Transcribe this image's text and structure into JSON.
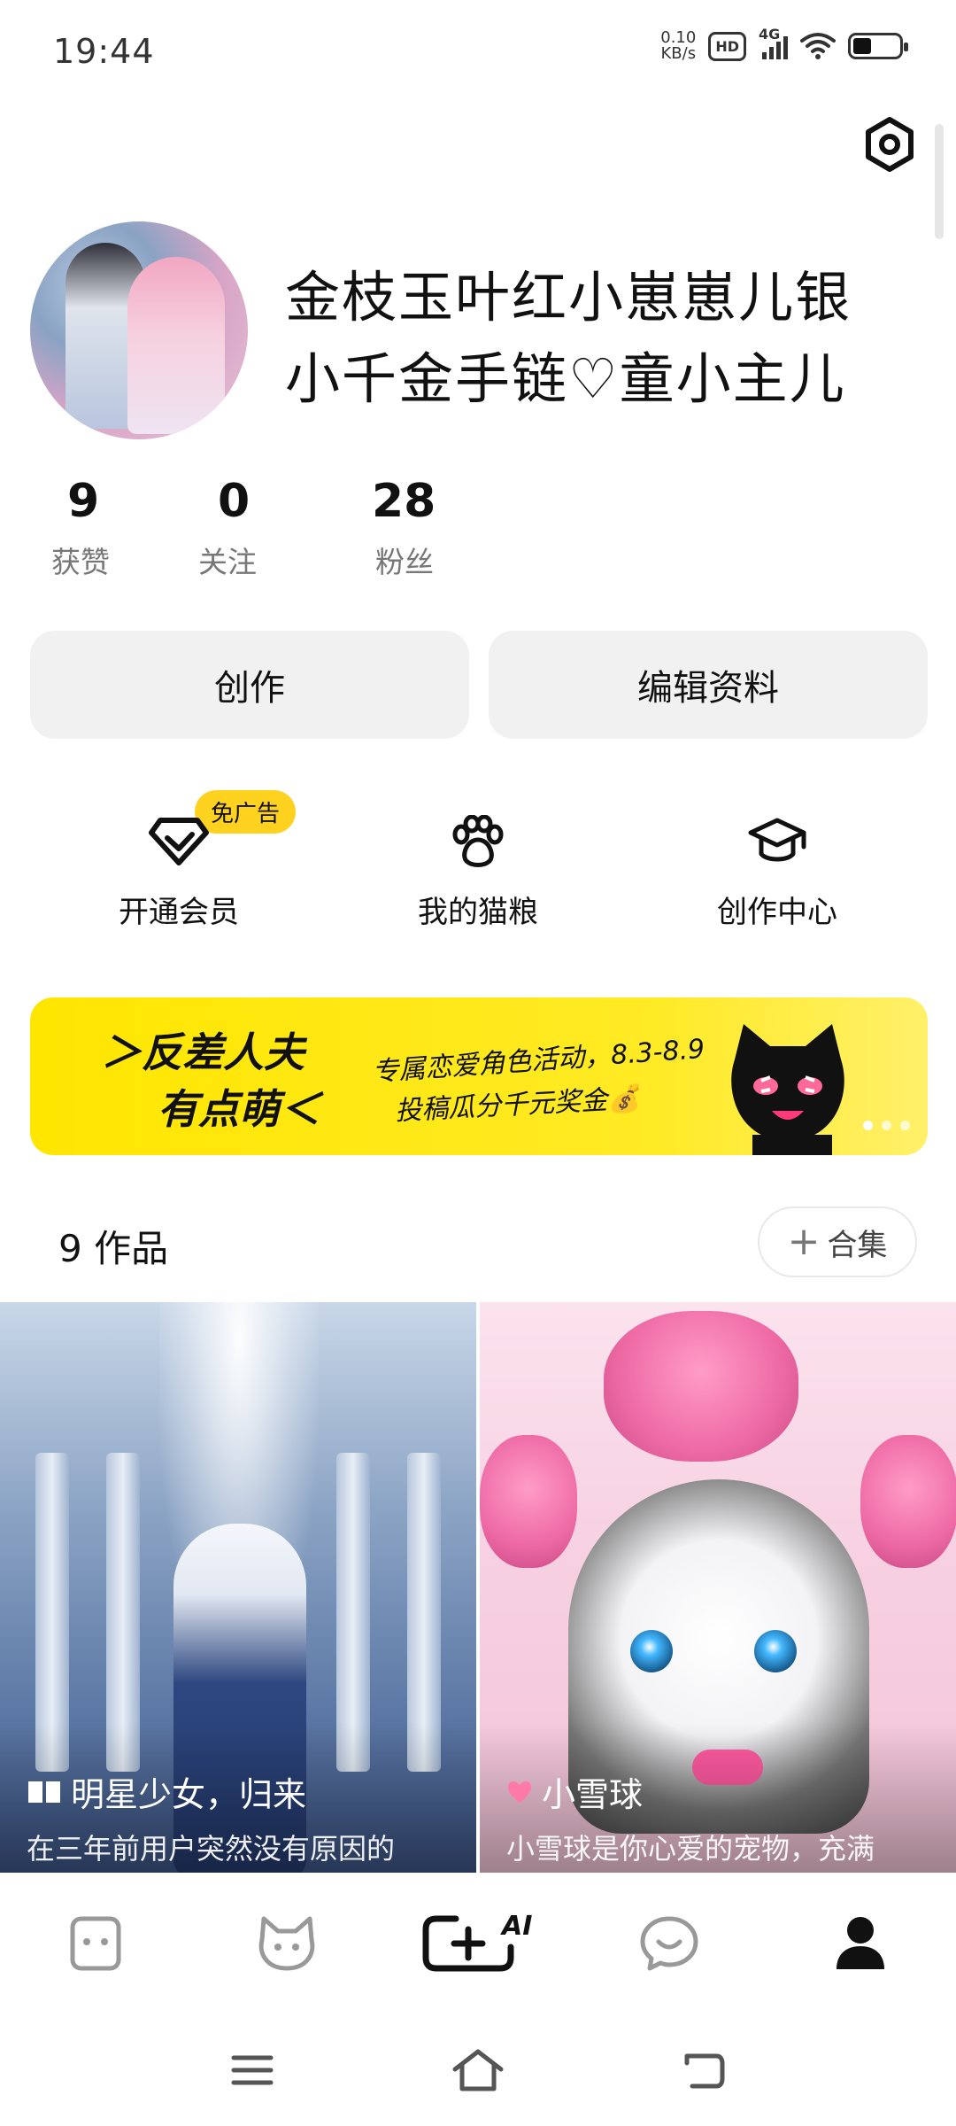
{
  "status_bar": {
    "time": "19:44",
    "net_speed_value": "0.10",
    "net_speed_unit": "KB/s",
    "hd_label": "HD",
    "network_label": "4G",
    "battery_level": 0.4
  },
  "profile": {
    "username": "金枝玉叶红小崽崽儿银小千金手链♡童小主儿",
    "stats": [
      {
        "value": "9",
        "label": "获赞"
      },
      {
        "value": "0",
        "label": "关注"
      },
      {
        "value": "28",
        "label": "粉丝"
      }
    ]
  },
  "actions": {
    "create_label": "创作",
    "edit_label": "编辑资料"
  },
  "quick_links": {
    "ad_badge": "免广告",
    "items": [
      {
        "label": "开通会员",
        "icon": "vip-diamond-icon"
      },
      {
        "label": "我的猫粮",
        "icon": "paw-icon"
      },
      {
        "label": "创作中心",
        "icon": "graduation-cap-icon"
      }
    ]
  },
  "banner": {
    "title_line1": "＞反差人夫",
    "title_line2": "有点萌＜",
    "sub_line1": "专属恋爱角色活动，8.3-8.9",
    "sub_line2": "投稿瓜分千元奖金💰",
    "active_index": 0,
    "page_count": 3
  },
  "works": {
    "count_label": "9 作品",
    "collection_label": "合集",
    "cards": [
      {
        "title": "明星少女，归来",
        "description": "在三年前用户突然没有原因的",
        "icon": "book-icon"
      },
      {
        "title": "小雪球",
        "description": "小雪球是你心爱的宠物，充满",
        "icon": "heart-icon"
      }
    ]
  },
  "bottom_nav": {
    "ai_label": "AI",
    "items": [
      "chat-face-icon",
      "cat-face-icon",
      "create-ai-icon",
      "message-icon",
      "profile-icon"
    ],
    "active": "profile-icon"
  },
  "colors": {
    "accent_yellow": "#ffe600",
    "button_bg": "#f1f1f1",
    "text_primary": "#111111",
    "text_secondary": "#777777"
  }
}
